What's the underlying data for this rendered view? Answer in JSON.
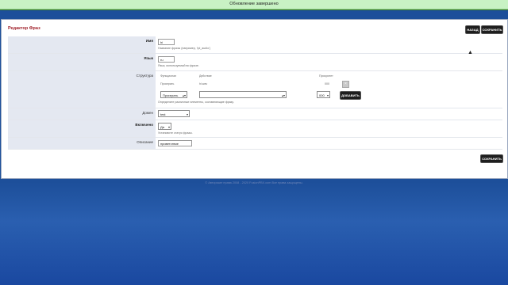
{
  "notice": {
    "text": "Обновление завершено"
  },
  "editor": {
    "title": "Редактор Фраз",
    "back_label": "НАЗАД",
    "save_label": "СОХРАНИТЬ",
    "save_bottom_label": "СОХРАНИТЬ"
  },
  "fields": {
    "name": {
      "label": "Имя",
      "value": "hi",
      "hint": "Название фразы (например, 'tpl_audio')"
    },
    "lang": {
      "label": "Язык",
      "value": "ru",
      "hint": "Язык, используемый во фразе."
    },
    "structure": {
      "label": "Структура",
      "col_function": "Функционал",
      "col_action": "Действие",
      "col_priority": "Приоритет",
      "row_function": "Проиграть",
      "row_action": "hi.wav",
      "row_priority": "000",
      "select_function": "Проиграть",
      "select_action": "",
      "select_priority": "000",
      "add_label": "ДОБАВИТЬ",
      "hint": "Определите различные элементы, составляющие фразу."
    },
    "domain": {
      "label": "Домен",
      "value": "test"
    },
    "enabled": {
      "label": "Включено",
      "value": "Да",
      "hint": "Установите статус фразы."
    },
    "description": {
      "label": "Описание",
      "value": "приветствие"
    }
  },
  "footer": {
    "text": "© Авторские права 2008 - 2020 FusionPBX.com Все права защищены."
  }
}
